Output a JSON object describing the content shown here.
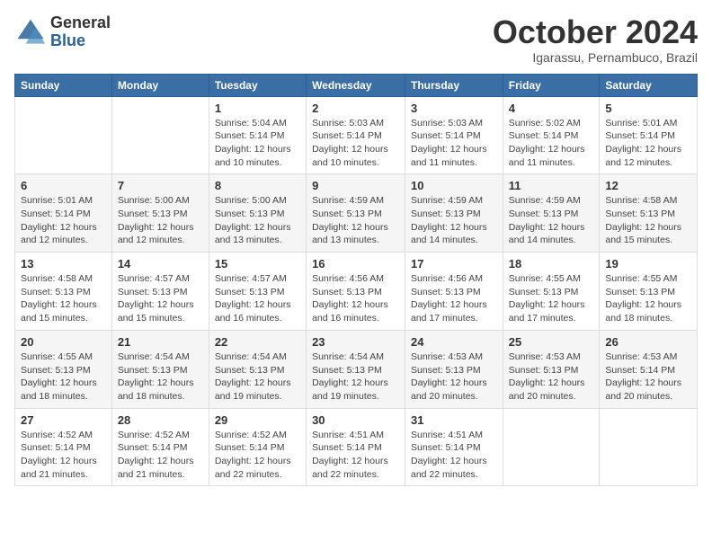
{
  "logo": {
    "line1": "General",
    "line2": "Blue"
  },
  "title": "October 2024",
  "subtitle": "Igarassu, Pernambuco, Brazil",
  "days_of_week": [
    "Sunday",
    "Monday",
    "Tuesday",
    "Wednesday",
    "Thursday",
    "Friday",
    "Saturday"
  ],
  "weeks": [
    [
      {
        "day": "",
        "info": ""
      },
      {
        "day": "",
        "info": ""
      },
      {
        "day": "1",
        "info": "Sunrise: 5:04 AM\nSunset: 5:14 PM\nDaylight: 12 hours\nand 10 minutes."
      },
      {
        "day": "2",
        "info": "Sunrise: 5:03 AM\nSunset: 5:14 PM\nDaylight: 12 hours\nand 10 minutes."
      },
      {
        "day": "3",
        "info": "Sunrise: 5:03 AM\nSunset: 5:14 PM\nDaylight: 12 hours\nand 11 minutes."
      },
      {
        "day": "4",
        "info": "Sunrise: 5:02 AM\nSunset: 5:14 PM\nDaylight: 12 hours\nand 11 minutes."
      },
      {
        "day": "5",
        "info": "Sunrise: 5:01 AM\nSunset: 5:14 PM\nDaylight: 12 hours\nand 12 minutes."
      }
    ],
    [
      {
        "day": "6",
        "info": "Sunrise: 5:01 AM\nSunset: 5:14 PM\nDaylight: 12 hours\nand 12 minutes."
      },
      {
        "day": "7",
        "info": "Sunrise: 5:00 AM\nSunset: 5:13 PM\nDaylight: 12 hours\nand 12 minutes."
      },
      {
        "day": "8",
        "info": "Sunrise: 5:00 AM\nSunset: 5:13 PM\nDaylight: 12 hours\nand 13 minutes."
      },
      {
        "day": "9",
        "info": "Sunrise: 4:59 AM\nSunset: 5:13 PM\nDaylight: 12 hours\nand 13 minutes."
      },
      {
        "day": "10",
        "info": "Sunrise: 4:59 AM\nSunset: 5:13 PM\nDaylight: 12 hours\nand 14 minutes."
      },
      {
        "day": "11",
        "info": "Sunrise: 4:59 AM\nSunset: 5:13 PM\nDaylight: 12 hours\nand 14 minutes."
      },
      {
        "day": "12",
        "info": "Sunrise: 4:58 AM\nSunset: 5:13 PM\nDaylight: 12 hours\nand 15 minutes."
      }
    ],
    [
      {
        "day": "13",
        "info": "Sunrise: 4:58 AM\nSunset: 5:13 PM\nDaylight: 12 hours\nand 15 minutes."
      },
      {
        "day": "14",
        "info": "Sunrise: 4:57 AM\nSunset: 5:13 PM\nDaylight: 12 hours\nand 15 minutes."
      },
      {
        "day": "15",
        "info": "Sunrise: 4:57 AM\nSunset: 5:13 PM\nDaylight: 12 hours\nand 16 minutes."
      },
      {
        "day": "16",
        "info": "Sunrise: 4:56 AM\nSunset: 5:13 PM\nDaylight: 12 hours\nand 16 minutes."
      },
      {
        "day": "17",
        "info": "Sunrise: 4:56 AM\nSunset: 5:13 PM\nDaylight: 12 hours\nand 17 minutes."
      },
      {
        "day": "18",
        "info": "Sunrise: 4:55 AM\nSunset: 5:13 PM\nDaylight: 12 hours\nand 17 minutes."
      },
      {
        "day": "19",
        "info": "Sunrise: 4:55 AM\nSunset: 5:13 PM\nDaylight: 12 hours\nand 18 minutes."
      }
    ],
    [
      {
        "day": "20",
        "info": "Sunrise: 4:55 AM\nSunset: 5:13 PM\nDaylight: 12 hours\nand 18 minutes."
      },
      {
        "day": "21",
        "info": "Sunrise: 4:54 AM\nSunset: 5:13 PM\nDaylight: 12 hours\nand 18 minutes."
      },
      {
        "day": "22",
        "info": "Sunrise: 4:54 AM\nSunset: 5:13 PM\nDaylight: 12 hours\nand 19 minutes."
      },
      {
        "day": "23",
        "info": "Sunrise: 4:54 AM\nSunset: 5:13 PM\nDaylight: 12 hours\nand 19 minutes."
      },
      {
        "day": "24",
        "info": "Sunrise: 4:53 AM\nSunset: 5:13 PM\nDaylight: 12 hours\nand 20 minutes."
      },
      {
        "day": "25",
        "info": "Sunrise: 4:53 AM\nSunset: 5:13 PM\nDaylight: 12 hours\nand 20 minutes."
      },
      {
        "day": "26",
        "info": "Sunrise: 4:53 AM\nSunset: 5:14 PM\nDaylight: 12 hours\nand 20 minutes."
      }
    ],
    [
      {
        "day": "27",
        "info": "Sunrise: 4:52 AM\nSunset: 5:14 PM\nDaylight: 12 hours\nand 21 minutes."
      },
      {
        "day": "28",
        "info": "Sunrise: 4:52 AM\nSunset: 5:14 PM\nDaylight: 12 hours\nand 21 minutes."
      },
      {
        "day": "29",
        "info": "Sunrise: 4:52 AM\nSunset: 5:14 PM\nDaylight: 12 hours\nand 22 minutes."
      },
      {
        "day": "30",
        "info": "Sunrise: 4:51 AM\nSunset: 5:14 PM\nDaylight: 12 hours\nand 22 minutes."
      },
      {
        "day": "31",
        "info": "Sunrise: 4:51 AM\nSunset: 5:14 PM\nDaylight: 12 hours\nand 22 minutes."
      },
      {
        "day": "",
        "info": ""
      },
      {
        "day": "",
        "info": ""
      }
    ]
  ]
}
